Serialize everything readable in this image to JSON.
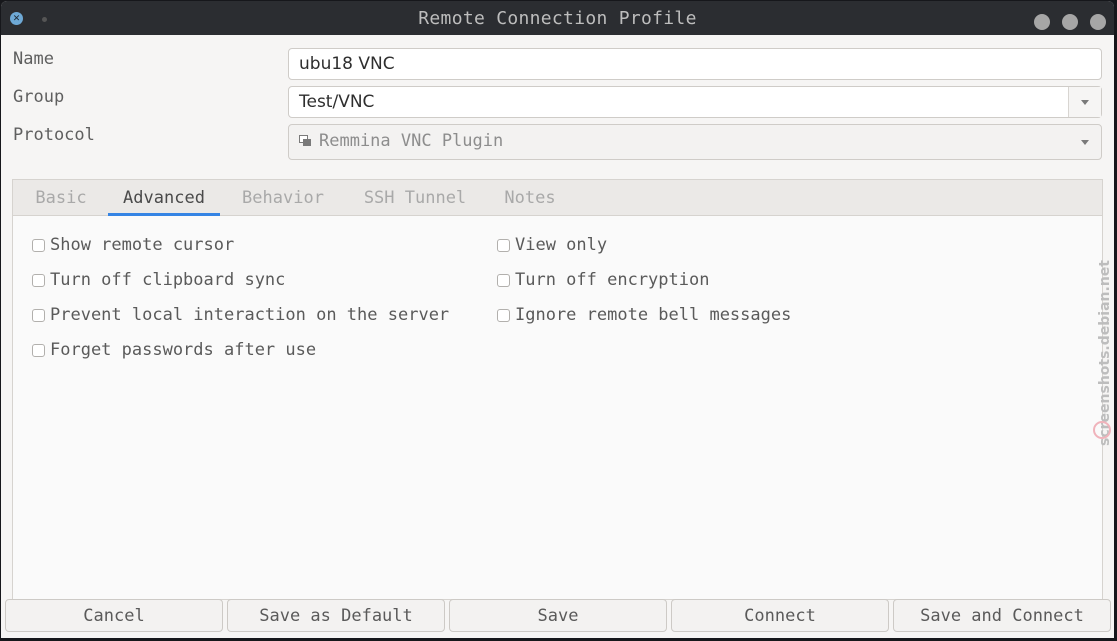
{
  "window": {
    "title": "Remote Connection Profile"
  },
  "form": {
    "name_label": "Name",
    "name_value": "ubu18 VNC",
    "group_label": "Group",
    "group_value": "Test/VNC",
    "protocol_label": "Protocol",
    "protocol_value": "Remmina VNC Plugin"
  },
  "tabs": [
    {
      "label": "Basic"
    },
    {
      "label": "Advanced"
    },
    {
      "label": "Behavior"
    },
    {
      "label": "SSH Tunnel"
    },
    {
      "label": "Notes"
    }
  ],
  "active_tab": "Advanced",
  "options": {
    "show_remote_cursor": {
      "label": "Show remote cursor",
      "checked": false
    },
    "view_only": {
      "label": "View only",
      "checked": false
    },
    "turn_off_clipboard_sync": {
      "label": "Turn off clipboard sync",
      "checked": false
    },
    "turn_off_encryption": {
      "label": "Turn off encryption",
      "checked": false
    },
    "prevent_local_interaction": {
      "label": "Prevent local interaction on the server",
      "checked": false
    },
    "ignore_remote_bell": {
      "label": "Ignore remote bell messages",
      "checked": false
    },
    "forget_passwords": {
      "label": "Forget passwords after use",
      "checked": false
    }
  },
  "buttons": {
    "cancel": "Cancel",
    "save_default": "Save as Default",
    "save": "Save",
    "connect": "Connect",
    "save_connect": "Save and Connect"
  },
  "watermark": "screenshots.debian.net",
  "colors": {
    "accent": "#3584e4",
    "titlebar": "#2b2d31"
  }
}
